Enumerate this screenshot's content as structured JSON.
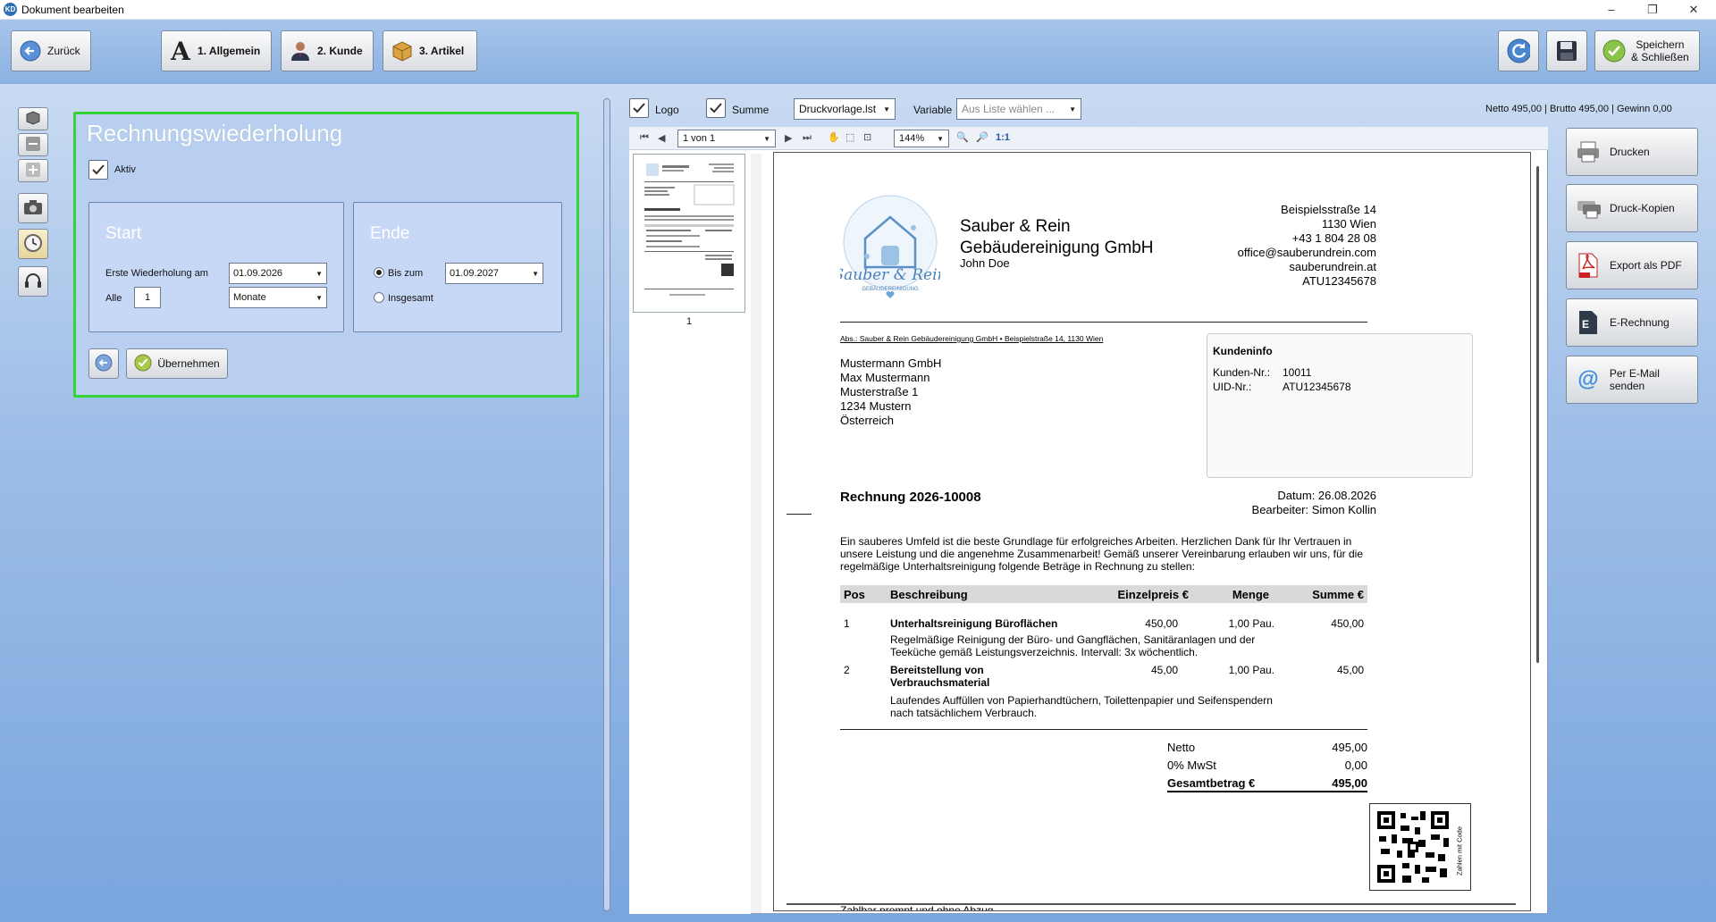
{
  "window": {
    "title": "Dokument bearbeiten",
    "app_icon": "KD"
  },
  "toolbar": {
    "back_label": "Zurück",
    "tabs": [
      {
        "label": "1. Allgemein"
      },
      {
        "label": "2. Kunde"
      },
      {
        "label": "3. Artikel"
      }
    ],
    "save_close_line1": "Speichern",
    "save_close_line2": "& Schließen"
  },
  "panel": {
    "title": "Rechnungswiederholung",
    "active_label": "Aktiv",
    "active_checked": true,
    "start": {
      "title": "Start",
      "first_label": "Erste Wiederholung am",
      "first_value": "01.09.2026",
      "every_label": "Alle",
      "every_value": "1",
      "unit_value": "Monate"
    },
    "end": {
      "title": "Ende",
      "until_label": "Bis zum",
      "until_value": "01.09.2027",
      "total_label": "Insgesamt",
      "selected": "Bis zum"
    },
    "apply_label": "Übernehmen"
  },
  "preview": {
    "logo_label": "Logo",
    "sum_label": "Summe",
    "template_value": "Druckvorlage.lst",
    "variable_label": "Variable",
    "variable_placeholder": "Aus Liste wählen ...",
    "totals_summary": "Netto 495,00 | Brutto 495,00 | Gewinn 0,00",
    "page_field": "1 von 1",
    "zoom_value": "144%",
    "zoom_11": "1:1",
    "thumb_page_no": "1"
  },
  "actions": [
    {
      "label": "Drucken"
    },
    {
      "label": "Druck-Kopien"
    },
    {
      "label": "Export als PDF"
    },
    {
      "label": "E-Rechnung"
    },
    {
      "label": "Per E-Mail senden"
    }
  ],
  "document": {
    "company_line1": "Sauber & Rein",
    "company_line2": "Gebäudereinigung GmbH",
    "company_contact": "John Doe",
    "logo_text": "Sauber & Rein",
    "logo_sub": "GEBÄUDEREINIGUNG",
    "address": [
      "Beispielsstraße 14",
      "1130 Wien",
      "+43 1 804 28 08",
      "office@sauberundrein.com",
      "sauberundrein.at",
      "ATU12345678"
    ],
    "sender_line": "Abs.: Sauber & Rein Gebäudereinigung GmbH • Beispielstraße 14, 1130 Wien",
    "recipient": [
      "Mustermann GmbH",
      "Max Mustermann",
      "Musterstraße 1",
      "1234 Mustern",
      "Österreich"
    ],
    "customer_info": {
      "title": "Kundeninfo",
      "no_label": "Kunden-Nr.:",
      "no_value": "10011",
      "uid_label": "UID-Nr.:",
      "uid_value": "ATU12345678"
    },
    "invoice_title": "Rechnung 2026-10008",
    "date_line": "Datum: 26.08.2026",
    "editor_line": "Bearbeiter: Simon Kollin",
    "intro": "Ein sauberes Umfeld ist die beste Grundlage für erfolgreiches Arbeiten. Herzlichen Dank für Ihr Vertrauen in unsere Leistung und die angenehme Zusammenarbeit! Gemäß unserer Vereinbarung erlauben wir uns, für die regelmäßige Unterhaltsreinigung folgende Beträge in Rechnung zu stellen:",
    "columns": [
      "Pos",
      "Beschreibung",
      "Einzelpreis €",
      "Menge",
      "Summe €"
    ],
    "items": [
      {
        "pos": "1",
        "title": "Unterhaltsreinigung Büroflächen",
        "desc": "Regelmäßige Reinigung der Büro- und Gangflächen, Sanitäranlagen und der Teeküche gemäß Leistungsverzeichnis. Intervall: 3x wöchentlich.",
        "price": "450,00",
        "qty": "1,00 Pau.",
        "sum": "450,00"
      },
      {
        "pos": "2",
        "title": "Bereitstellung von Verbrauchsmaterial",
        "desc": "Laufendes Auffüllen von Papierhandtüchern, Toilettenpapier und Seifenspendern nach tatsächlichem Verbrauch.",
        "price": "45,00",
        "qty": "1,00 Pau.",
        "sum": "45,00"
      }
    ],
    "totals": [
      {
        "label": "Netto",
        "value": "495,00"
      },
      {
        "label": "0% MwSt",
        "value": "0,00"
      },
      {
        "label": "Gesamtbetrag €",
        "value": "495,00"
      }
    ],
    "qr_label": "Zahlen mit Code",
    "footer_cut": "Zahlbar prompt und ohne Abzug"
  }
}
